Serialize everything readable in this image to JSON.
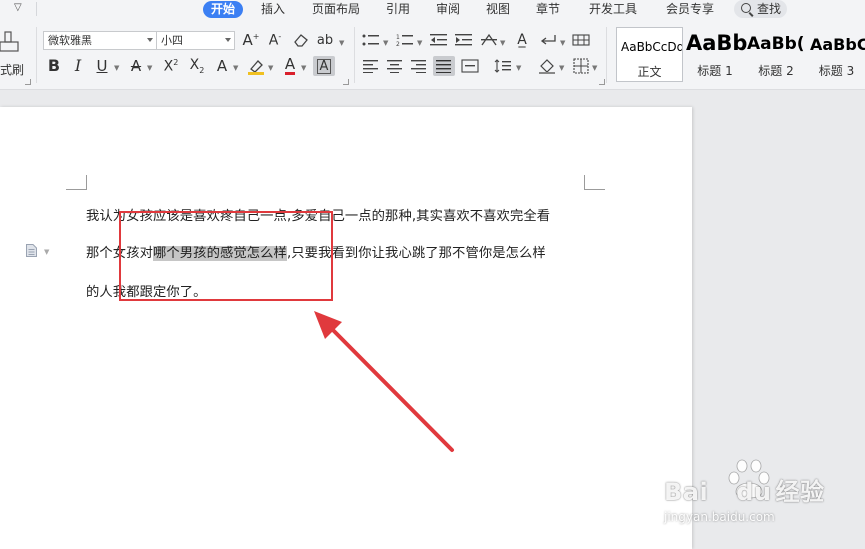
{
  "menu": {
    "items": [
      "开始",
      "插入",
      "页面布局",
      "引用",
      "审阅",
      "视图",
      "章节",
      "开发工具",
      "会员专享"
    ],
    "active_index": 0,
    "search_label": "查找",
    "accent_color": "#3b7ff3"
  },
  "ribbon": {
    "format_painter_label": "式刷",
    "font_name": "微软雅黑",
    "font_size": "小四",
    "styles": [
      {
        "preview": "AaBbCcDd",
        "caption": "正文"
      },
      {
        "preview": "AaBb",
        "caption": "标题 1"
      },
      {
        "preview": "AaBb(",
        "caption": "标题 2"
      },
      {
        "preview": "AaBbC",
        "caption": "标题 3"
      }
    ]
  },
  "document": {
    "line1": "我认为女孩应该是喜欢疼自己一点,多爱自己一点的那种,其实喜欢不喜欢完全看",
    "line2_before": "那个女孩对",
    "line2_selected": "哪个男孩的感觉怎么样",
    "line2_after": ",只要我看到你让我心跳了那不管你是怎么样",
    "line3": "的人我都跟定你了。"
  },
  "annotation": {
    "color": "#e0393d"
  },
  "watermark": {
    "brand_a": "Bai",
    "brand_b": "du",
    "brand_cn": "经验",
    "url": "jingyan.baidu.com"
  }
}
